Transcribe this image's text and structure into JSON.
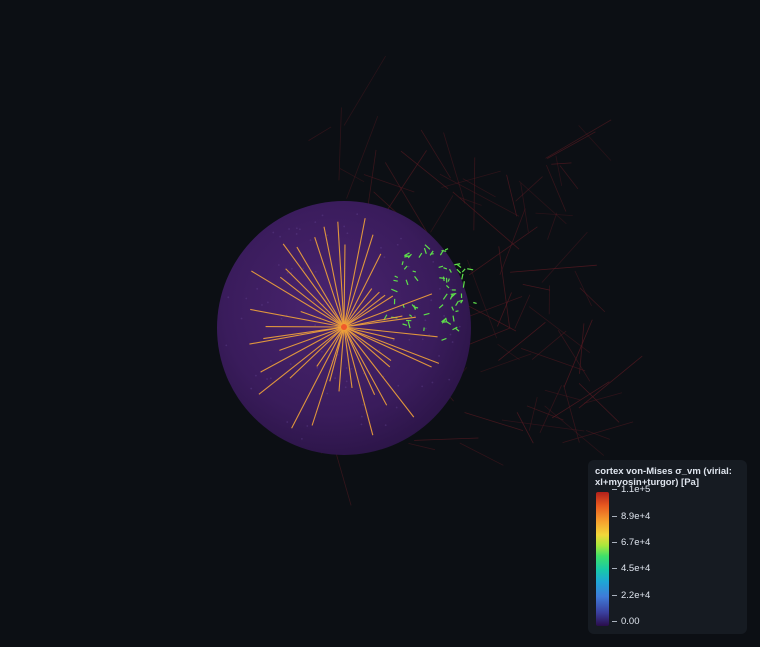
{
  "colorbar": {
    "title": "cortex von-Mises σ_vm (virial: xl+myosin+turgor) [Pa]",
    "ticks": [
      "1.1e+5",
      "8.9e+4",
      "6.7e+4",
      "4.5e+4",
      "2.2e+4",
      "0.00"
    ],
    "colors": {
      "min": "#2a0d4a",
      "mid": "#3ee06a",
      "max": "#b1201b"
    }
  },
  "scene": {
    "background": "#0c0f14",
    "cell_fill": "#3a1d5c",
    "aster_color": "#f2a33a",
    "filament_network_color": "#5a1a22",
    "crosslinker_color": "#5ee04a"
  }
}
